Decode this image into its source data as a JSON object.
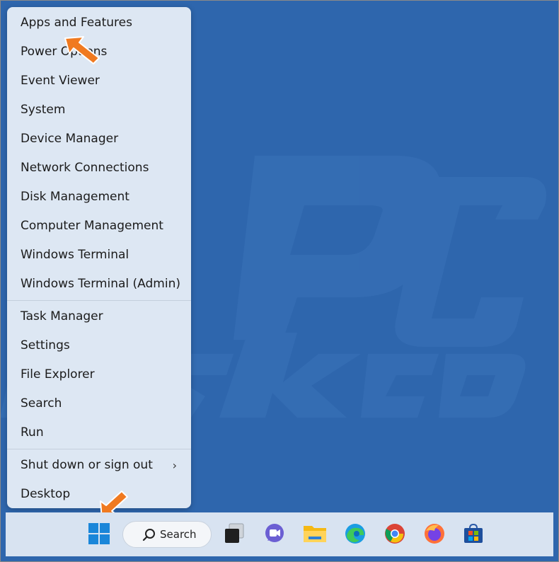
{
  "menu": {
    "items": [
      {
        "label": "Apps and Features"
      },
      {
        "label": "Power Options"
      },
      {
        "label": "Event Viewer"
      },
      {
        "label": "System"
      },
      {
        "label": "Device Manager"
      },
      {
        "label": "Network Connections"
      },
      {
        "label": "Disk Management"
      },
      {
        "label": "Computer Management"
      },
      {
        "label": "Windows Terminal"
      },
      {
        "label": "Windows Terminal (Admin)"
      },
      {
        "label": "Task Manager"
      },
      {
        "label": "Settings"
      },
      {
        "label": "File Explorer"
      },
      {
        "label": "Search"
      },
      {
        "label": "Run"
      },
      {
        "label": "Shut down or sign out"
      },
      {
        "label": "Desktop"
      }
    ]
  },
  "taskbar": {
    "search_label": "Search",
    "icons": [
      "start-icon",
      "search-icon",
      "task-view-icon",
      "teams-chat-icon",
      "file-explorer-icon",
      "edge-icon",
      "chrome-icon",
      "firefox-icon",
      "microsoft-store-icon"
    ]
  },
  "colors": {
    "desktop": "#2e66ad",
    "menu_bg": "#dde7f3",
    "taskbar_bg": "#d8e3f1",
    "arrow": "#f07a20"
  }
}
